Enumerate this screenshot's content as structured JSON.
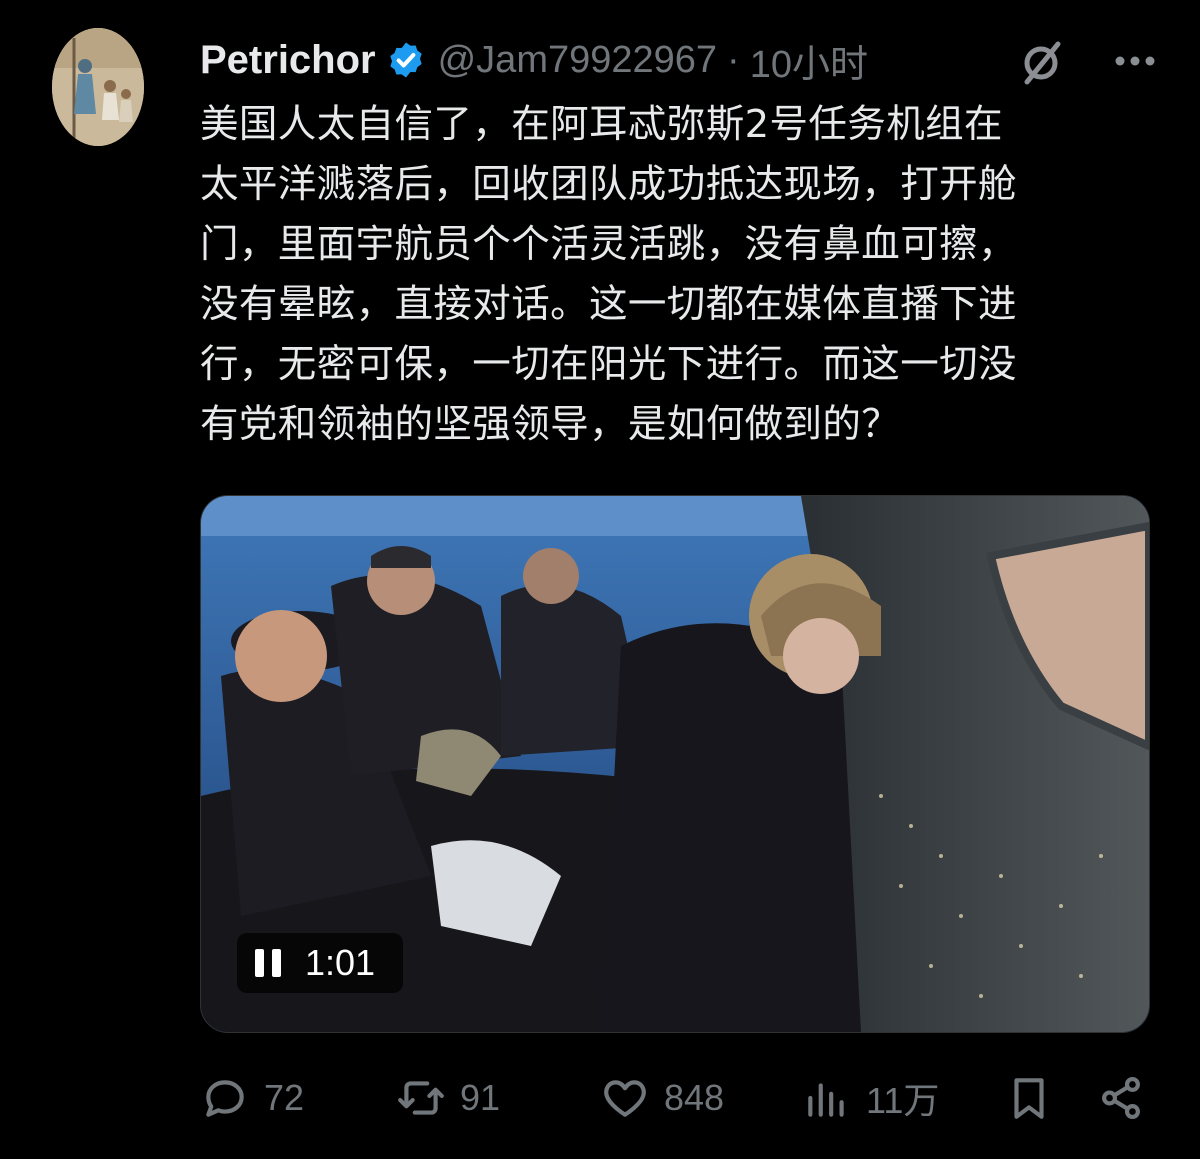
{
  "post": {
    "author_name": "Petrichor",
    "handle": "@Jam79922967",
    "separator": "·",
    "time": "10小时",
    "text_lines": [
      "美国人太自信了，在阿耳忒弥斯2号任务机组在",
      "太平洋溅落后，回收团队成功抵达现场，打开舱",
      "门，里面宇航员个个活灵活跳，没有鼻血可擦，",
      "没有晕眩，直接对话。这一切都在媒体直播下进",
      "行，无密可保，一切在阳光下进行。而这一切没",
      "有党和领袖的坚强领导，是如何做到的？"
    ],
    "video": {
      "duration": "1:01",
      "state": "playing"
    },
    "stats": {
      "replies": "72",
      "reposts": "91",
      "likes": "848",
      "views": "11万"
    }
  },
  "colors": {
    "background": "#000000",
    "text": "#e7e9ea",
    "muted": "#71767b",
    "verified": "#1d9bf0"
  },
  "icons": [
    "verified-badge-icon",
    "grok-icon",
    "more-icon",
    "pause-icon",
    "reply-icon",
    "repost-icon",
    "like-icon",
    "views-icon",
    "bookmark-icon",
    "share-icon"
  ]
}
